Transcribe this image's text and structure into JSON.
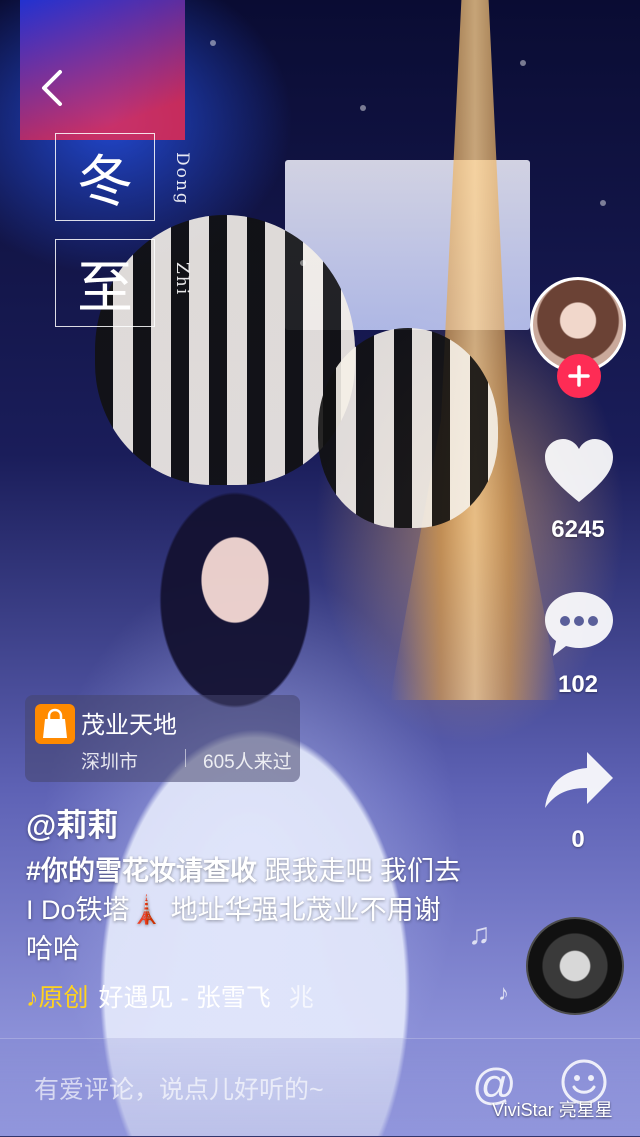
{
  "solar_term": {
    "char_top": "冬",
    "char_bottom": "至",
    "pinyin_top": "Dong",
    "pinyin_bottom": "Zhi"
  },
  "actions": {
    "likes": "6245",
    "comments": "102",
    "shares": "0"
  },
  "poi": {
    "name": "茂业天地",
    "city": "深圳市",
    "visits": "605人来过"
  },
  "post": {
    "author": "@莉莉",
    "hashtag": "#你的雪花妆请查收",
    "caption_part1": " 跟我走吧 我们去I Do铁塔",
    "caption_emoji": "🗼",
    "caption_part2": " 地址华强北茂业不用谢哈哈"
  },
  "music": {
    "note": "♪",
    "original_label": "原创",
    "song": "好遇见 - 张雪飞",
    "tail": "兆"
  },
  "comment_bar": {
    "placeholder": "有爱评论，说点儿好听的~"
  },
  "watermark": "ViviStar 亮星星",
  "icons": {
    "back": "chevron-left-icon",
    "follow": "plus-icon",
    "like": "heart-icon",
    "comment": "speech-bubble-icon",
    "share": "share-arrow-icon",
    "mention": "at-icon",
    "emoji": "smiley-icon"
  },
  "colors": {
    "follow_red": "#fe2c55",
    "music_yellow": "#ffd21e",
    "poi_orange": "#ff8a00"
  }
}
